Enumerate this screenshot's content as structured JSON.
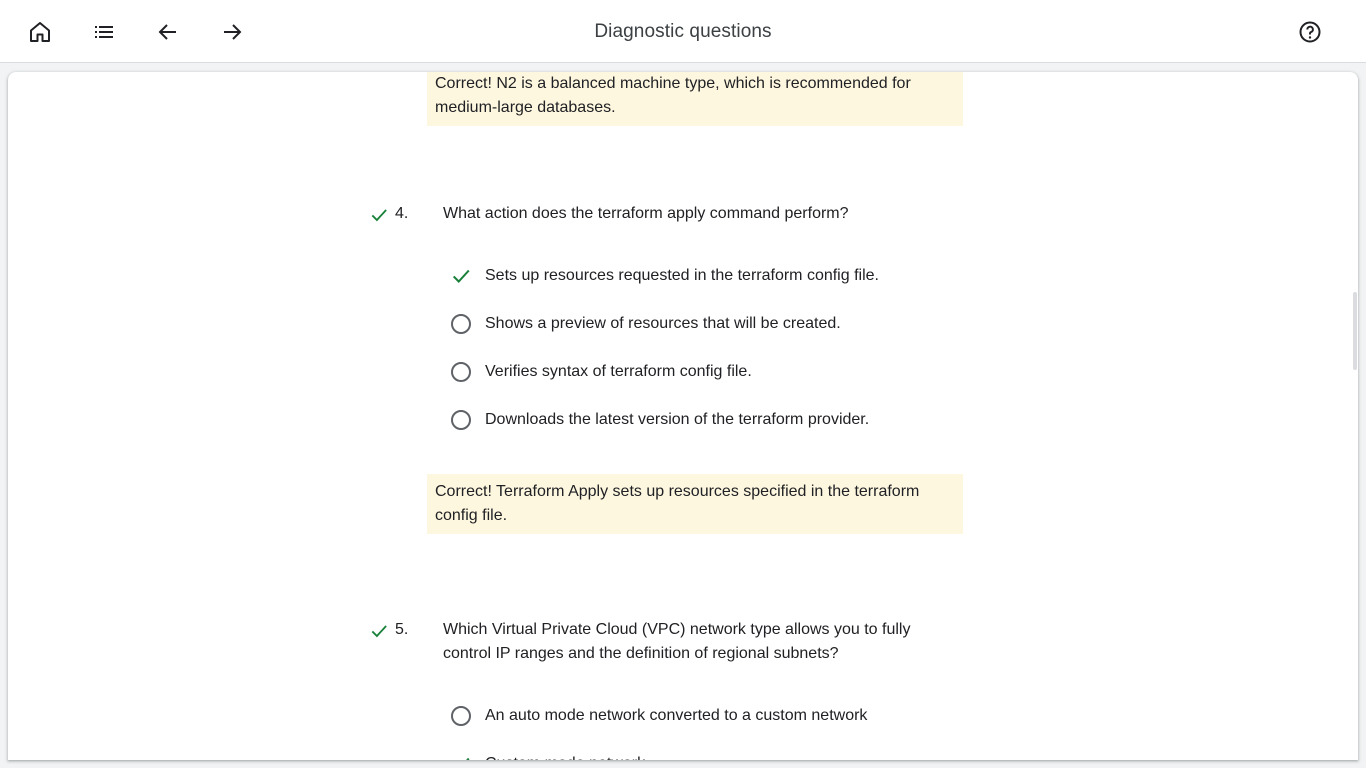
{
  "header": {
    "title": "Diagnostic questions",
    "icons": [
      "home-icon",
      "list-icon",
      "arrow-back-icon",
      "arrow-forward-icon",
      "help-icon"
    ]
  },
  "colors": {
    "check_green": "#188038",
    "feedback_bg": "#fef7e0",
    "radio_gray": "#5f6368"
  },
  "content": {
    "prev_feedback": "Correct! N2 is a balanced machine type, which is recommended for medium-large databases.",
    "q4": {
      "number": "4.",
      "text": "What action does the terraform apply command perform?",
      "options": [
        {
          "label": "Sets up resources requested in the terraform config file.",
          "state": "correct"
        },
        {
          "label": "Shows a preview of resources that will be created.",
          "state": "unselected"
        },
        {
          "label": "Verifies syntax of terraform config file.",
          "state": "unselected"
        },
        {
          "label": "Downloads the latest version of the terraform provider.",
          "state": "unselected"
        }
      ],
      "feedback": "Correct! Terraform Apply sets up resources specified in the terraform config file."
    },
    "q5": {
      "number": "5.",
      "text": "Which Virtual Private Cloud (VPC) network type allows you to fully control IP ranges and the definition of regional subnets?",
      "options": [
        {
          "label": "An auto mode network converted to a custom network",
          "state": "unselected"
        },
        {
          "label": "Custom mode network",
          "state": "correct"
        }
      ]
    }
  }
}
